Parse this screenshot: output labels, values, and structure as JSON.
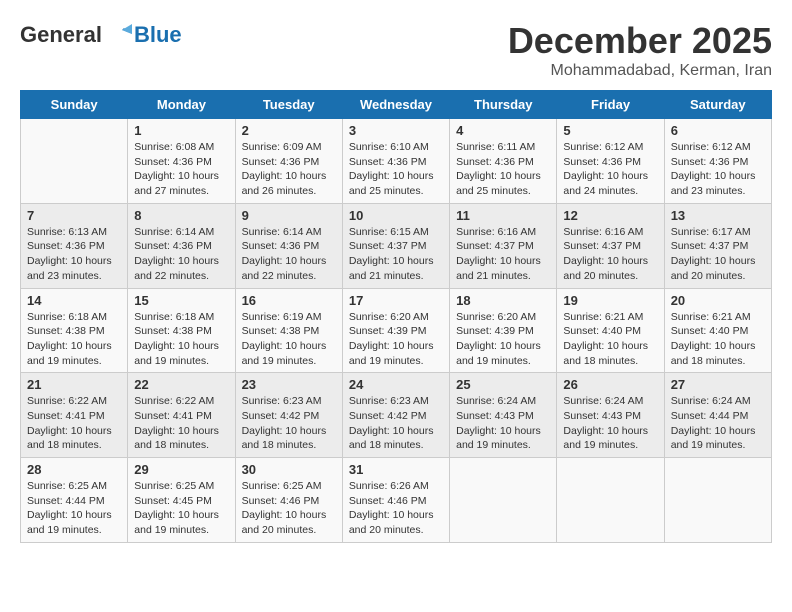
{
  "header": {
    "logo_general": "General",
    "logo_blue": "Blue",
    "month": "December 2025",
    "location": "Mohammadabad, Kerman, Iran"
  },
  "days_of_week": [
    "Sunday",
    "Monday",
    "Tuesday",
    "Wednesday",
    "Thursday",
    "Friday",
    "Saturday"
  ],
  "weeks": [
    [
      {
        "day": null,
        "info": null
      },
      {
        "day": "1",
        "info": "Sunrise: 6:08 AM\nSunset: 4:36 PM\nDaylight: 10 hours\nand 27 minutes."
      },
      {
        "day": "2",
        "info": "Sunrise: 6:09 AM\nSunset: 4:36 PM\nDaylight: 10 hours\nand 26 minutes."
      },
      {
        "day": "3",
        "info": "Sunrise: 6:10 AM\nSunset: 4:36 PM\nDaylight: 10 hours\nand 25 minutes."
      },
      {
        "day": "4",
        "info": "Sunrise: 6:11 AM\nSunset: 4:36 PM\nDaylight: 10 hours\nand 25 minutes."
      },
      {
        "day": "5",
        "info": "Sunrise: 6:12 AM\nSunset: 4:36 PM\nDaylight: 10 hours\nand 24 minutes."
      },
      {
        "day": "6",
        "info": "Sunrise: 6:12 AM\nSunset: 4:36 PM\nDaylight: 10 hours\nand 23 minutes."
      }
    ],
    [
      {
        "day": "7",
        "info": "Sunrise: 6:13 AM\nSunset: 4:36 PM\nDaylight: 10 hours\nand 23 minutes."
      },
      {
        "day": "8",
        "info": "Sunrise: 6:14 AM\nSunset: 4:36 PM\nDaylight: 10 hours\nand 22 minutes."
      },
      {
        "day": "9",
        "info": "Sunrise: 6:14 AM\nSunset: 4:36 PM\nDaylight: 10 hours\nand 22 minutes."
      },
      {
        "day": "10",
        "info": "Sunrise: 6:15 AM\nSunset: 4:37 PM\nDaylight: 10 hours\nand 21 minutes."
      },
      {
        "day": "11",
        "info": "Sunrise: 6:16 AM\nSunset: 4:37 PM\nDaylight: 10 hours\nand 21 minutes."
      },
      {
        "day": "12",
        "info": "Sunrise: 6:16 AM\nSunset: 4:37 PM\nDaylight: 10 hours\nand 20 minutes."
      },
      {
        "day": "13",
        "info": "Sunrise: 6:17 AM\nSunset: 4:37 PM\nDaylight: 10 hours\nand 20 minutes."
      }
    ],
    [
      {
        "day": "14",
        "info": "Sunrise: 6:18 AM\nSunset: 4:38 PM\nDaylight: 10 hours\nand 19 minutes."
      },
      {
        "day": "15",
        "info": "Sunrise: 6:18 AM\nSunset: 4:38 PM\nDaylight: 10 hours\nand 19 minutes."
      },
      {
        "day": "16",
        "info": "Sunrise: 6:19 AM\nSunset: 4:38 PM\nDaylight: 10 hours\nand 19 minutes."
      },
      {
        "day": "17",
        "info": "Sunrise: 6:20 AM\nSunset: 4:39 PM\nDaylight: 10 hours\nand 19 minutes."
      },
      {
        "day": "18",
        "info": "Sunrise: 6:20 AM\nSunset: 4:39 PM\nDaylight: 10 hours\nand 19 minutes."
      },
      {
        "day": "19",
        "info": "Sunrise: 6:21 AM\nSunset: 4:40 PM\nDaylight: 10 hours\nand 18 minutes."
      },
      {
        "day": "20",
        "info": "Sunrise: 6:21 AM\nSunset: 4:40 PM\nDaylight: 10 hours\nand 18 minutes."
      }
    ],
    [
      {
        "day": "21",
        "info": "Sunrise: 6:22 AM\nSunset: 4:41 PM\nDaylight: 10 hours\nand 18 minutes."
      },
      {
        "day": "22",
        "info": "Sunrise: 6:22 AM\nSunset: 4:41 PM\nDaylight: 10 hours\nand 18 minutes."
      },
      {
        "day": "23",
        "info": "Sunrise: 6:23 AM\nSunset: 4:42 PM\nDaylight: 10 hours\nand 18 minutes."
      },
      {
        "day": "24",
        "info": "Sunrise: 6:23 AM\nSunset: 4:42 PM\nDaylight: 10 hours\nand 18 minutes."
      },
      {
        "day": "25",
        "info": "Sunrise: 6:24 AM\nSunset: 4:43 PM\nDaylight: 10 hours\nand 19 minutes."
      },
      {
        "day": "26",
        "info": "Sunrise: 6:24 AM\nSunset: 4:43 PM\nDaylight: 10 hours\nand 19 minutes."
      },
      {
        "day": "27",
        "info": "Sunrise: 6:24 AM\nSunset: 4:44 PM\nDaylight: 10 hours\nand 19 minutes."
      }
    ],
    [
      {
        "day": "28",
        "info": "Sunrise: 6:25 AM\nSunset: 4:44 PM\nDaylight: 10 hours\nand 19 minutes."
      },
      {
        "day": "29",
        "info": "Sunrise: 6:25 AM\nSunset: 4:45 PM\nDaylight: 10 hours\nand 19 minutes."
      },
      {
        "day": "30",
        "info": "Sunrise: 6:25 AM\nSunset: 4:46 PM\nDaylight: 10 hours\nand 20 minutes."
      },
      {
        "day": "31",
        "info": "Sunrise: 6:26 AM\nSunset: 4:46 PM\nDaylight: 10 hours\nand 20 minutes."
      },
      {
        "day": null,
        "info": null
      },
      {
        "day": null,
        "info": null
      },
      {
        "day": null,
        "info": null
      }
    ]
  ]
}
